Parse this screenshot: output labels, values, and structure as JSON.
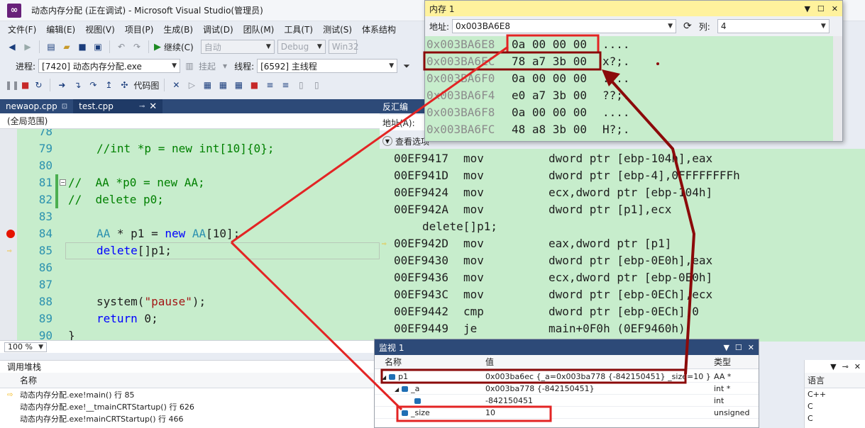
{
  "window": {
    "title": "动态内存分配 (正在调试) - Microsoft Visual Studio(管理员)",
    "logo": "∞"
  },
  "menu": [
    "文件(F)",
    "编辑(E)",
    "视图(V)",
    "项目(P)",
    "生成(B)",
    "调试(D)",
    "团队(M)",
    "工具(T)",
    "测试(S)",
    "体系结构"
  ],
  "toolbar1": {
    "continue_label": "继续(C)",
    "config": "自动",
    "mode": "Debug",
    "platform": "Win32"
  },
  "toolbar2": {
    "process_label": "进程:",
    "process_value": "[7420] 动态内存分配.exe",
    "suspend_label": "挂起",
    "thread_label": "线程:",
    "thread_value": "[6592] 主线程"
  },
  "toolbar3": {
    "codemap_label": "代码图"
  },
  "tabs": [
    {
      "label": "newaop.cpp",
      "pin": "⊡"
    },
    {
      "label": "test.cpp",
      "pin": "⊸",
      "close": "✕"
    }
  ],
  "scope": "(全局范围)",
  "code": [
    {
      "ln": "78",
      "segments": []
    },
    {
      "ln": "79",
      "segments": [
        {
          "t": "//int *p = new int[10]{0};",
          "c": "cm"
        }
      ]
    },
    {
      "ln": "80",
      "segments": []
    },
    {
      "ln": "81",
      "segments": [
        {
          "t": "//  AA *p0 = new AA;",
          "c": "cm"
        }
      ]
    },
    {
      "ln": "82",
      "segments": [
        {
          "t": "//  delete p0;",
          "c": "cm"
        }
      ]
    },
    {
      "ln": "83",
      "segments": []
    },
    {
      "ln": "84",
      "segments": [
        {
          "t": "AA",
          "c": "ty"
        },
        {
          "t": " * p1 = ",
          "c": ""
        },
        {
          "t": "new",
          "c": "kw"
        },
        {
          "t": " ",
          "c": ""
        },
        {
          "t": "AA",
          "c": "ty"
        },
        {
          "t": "[10];",
          "c": ""
        }
      ]
    },
    {
      "ln": "85",
      "segments": [
        {
          "t": "delete",
          "c": "kw"
        },
        {
          "t": "[]p1;",
          "c": ""
        }
      ]
    },
    {
      "ln": "86",
      "segments": []
    },
    {
      "ln": "87",
      "segments": []
    },
    {
      "ln": "88",
      "segments": [
        {
          "t": "system(",
          "c": ""
        },
        {
          "t": "\"pause\"",
          "c": "str"
        },
        {
          "t": ");",
          "c": ""
        }
      ]
    },
    {
      "ln": "89",
      "segments": [
        {
          "t": "return",
          "c": "kw"
        },
        {
          "t": " 0;",
          "c": ""
        }
      ]
    },
    {
      "ln": "90",
      "segments": [
        {
          "t": "}",
          "c": ""
        }
      ]
    }
  ],
  "zoom": "100 %",
  "disasm_panel": {
    "tab_label": "反汇编",
    "addr_label": "地址(A):",
    "opts_label": "查看选项"
  },
  "disasm": [
    {
      "addr": "00EF9417",
      "mn": "mov",
      "op": "dword ptr [ebp-104h],eax"
    },
    {
      "addr": "00EF941D",
      "mn": "mov",
      "op": "dword ptr [ebp-4],0FFFFFFFFh"
    },
    {
      "addr": "00EF9424",
      "mn": "mov",
      "op": "ecx,dword ptr [ebp-104h]"
    },
    {
      "addr": "00EF942A",
      "mn": "mov",
      "op": "dword ptr [p1],ecx"
    },
    {
      "src": "delete[]p1;"
    },
    {
      "addr": "00EF942D",
      "mn": "mov",
      "op": "eax,dword ptr [p1]"
    },
    {
      "addr": "00EF9430",
      "mn": "mov",
      "op": "dword ptr [ebp-0E0h],eax"
    },
    {
      "addr": "00EF9436",
      "mn": "mov",
      "op": "ecx,dword ptr [ebp-0E0h]"
    },
    {
      "addr": "00EF943C",
      "mn": "mov",
      "op": "dword ptr [ebp-0ECh],ecx"
    },
    {
      "addr": "00EF9442",
      "mn": "cmp",
      "op": "dword ptr [ebp-0ECh],0"
    },
    {
      "addr": "00EF9449",
      "mn": "je",
      "op": "main+0F0h (0EF9460h)"
    }
  ],
  "memory": {
    "title": "内存 1",
    "addr_label": "地址:",
    "addr_value": "0x003BA6E8",
    "col_label": "列:",
    "col_value": "4",
    "rows": [
      {
        "addr": "0x003BA6E8",
        "hex": "0a 00 00 00",
        "ascii": "...."
      },
      {
        "addr": "0x003BA6EC",
        "hex": "78 a7 3b 00",
        "ascii": "x?;."
      },
      {
        "addr": "0x003BA6F0",
        "hex": "0a 00 00 00",
        "ascii": "...."
      },
      {
        "addr": "0x003BA6F4",
        "hex": "e0 a7 3b 00",
        "ascii": "??;."
      },
      {
        "addr": "0x003BA6F8",
        "hex": "0a 00 00 00",
        "ascii": "...."
      },
      {
        "addr": "0x003BA6FC",
        "hex": "48 a8 3b 00",
        "ascii": "H?;."
      }
    ]
  },
  "callstack": {
    "title": "调用堆栈",
    "col_name": "名称",
    "rows": [
      "动态内存分配.exe!main() 行 85",
      "动态内存分配.exe!__tmainCRTStartup() 行 626",
      "动态内存分配.exe!mainCRTStartup() 行 466"
    ]
  },
  "watch": {
    "title": "监视 1",
    "col_name": "名称",
    "col_value": "值",
    "col_type": "类型",
    "rows": [
      {
        "name": "p1",
        "value": "0x003ba6ec {_a=0x003ba778 {-842150451} _size=10 }",
        "type": "AA *",
        "expand": "◢",
        "indent": 0
      },
      {
        "name": "_a",
        "value": "0x003ba778 {-842150451}",
        "type": "int *",
        "expand": "◢",
        "indent": 1
      },
      {
        "name": "",
        "value": "-842150451",
        "type": "int",
        "expand": "",
        "indent": 2
      },
      {
        "name": "_size",
        "value": "10",
        "type": "unsigned",
        "expand": "",
        "indent": 1
      }
    ]
  },
  "lang": {
    "col": "语言",
    "rows": [
      "C++",
      "C",
      "C"
    ]
  }
}
